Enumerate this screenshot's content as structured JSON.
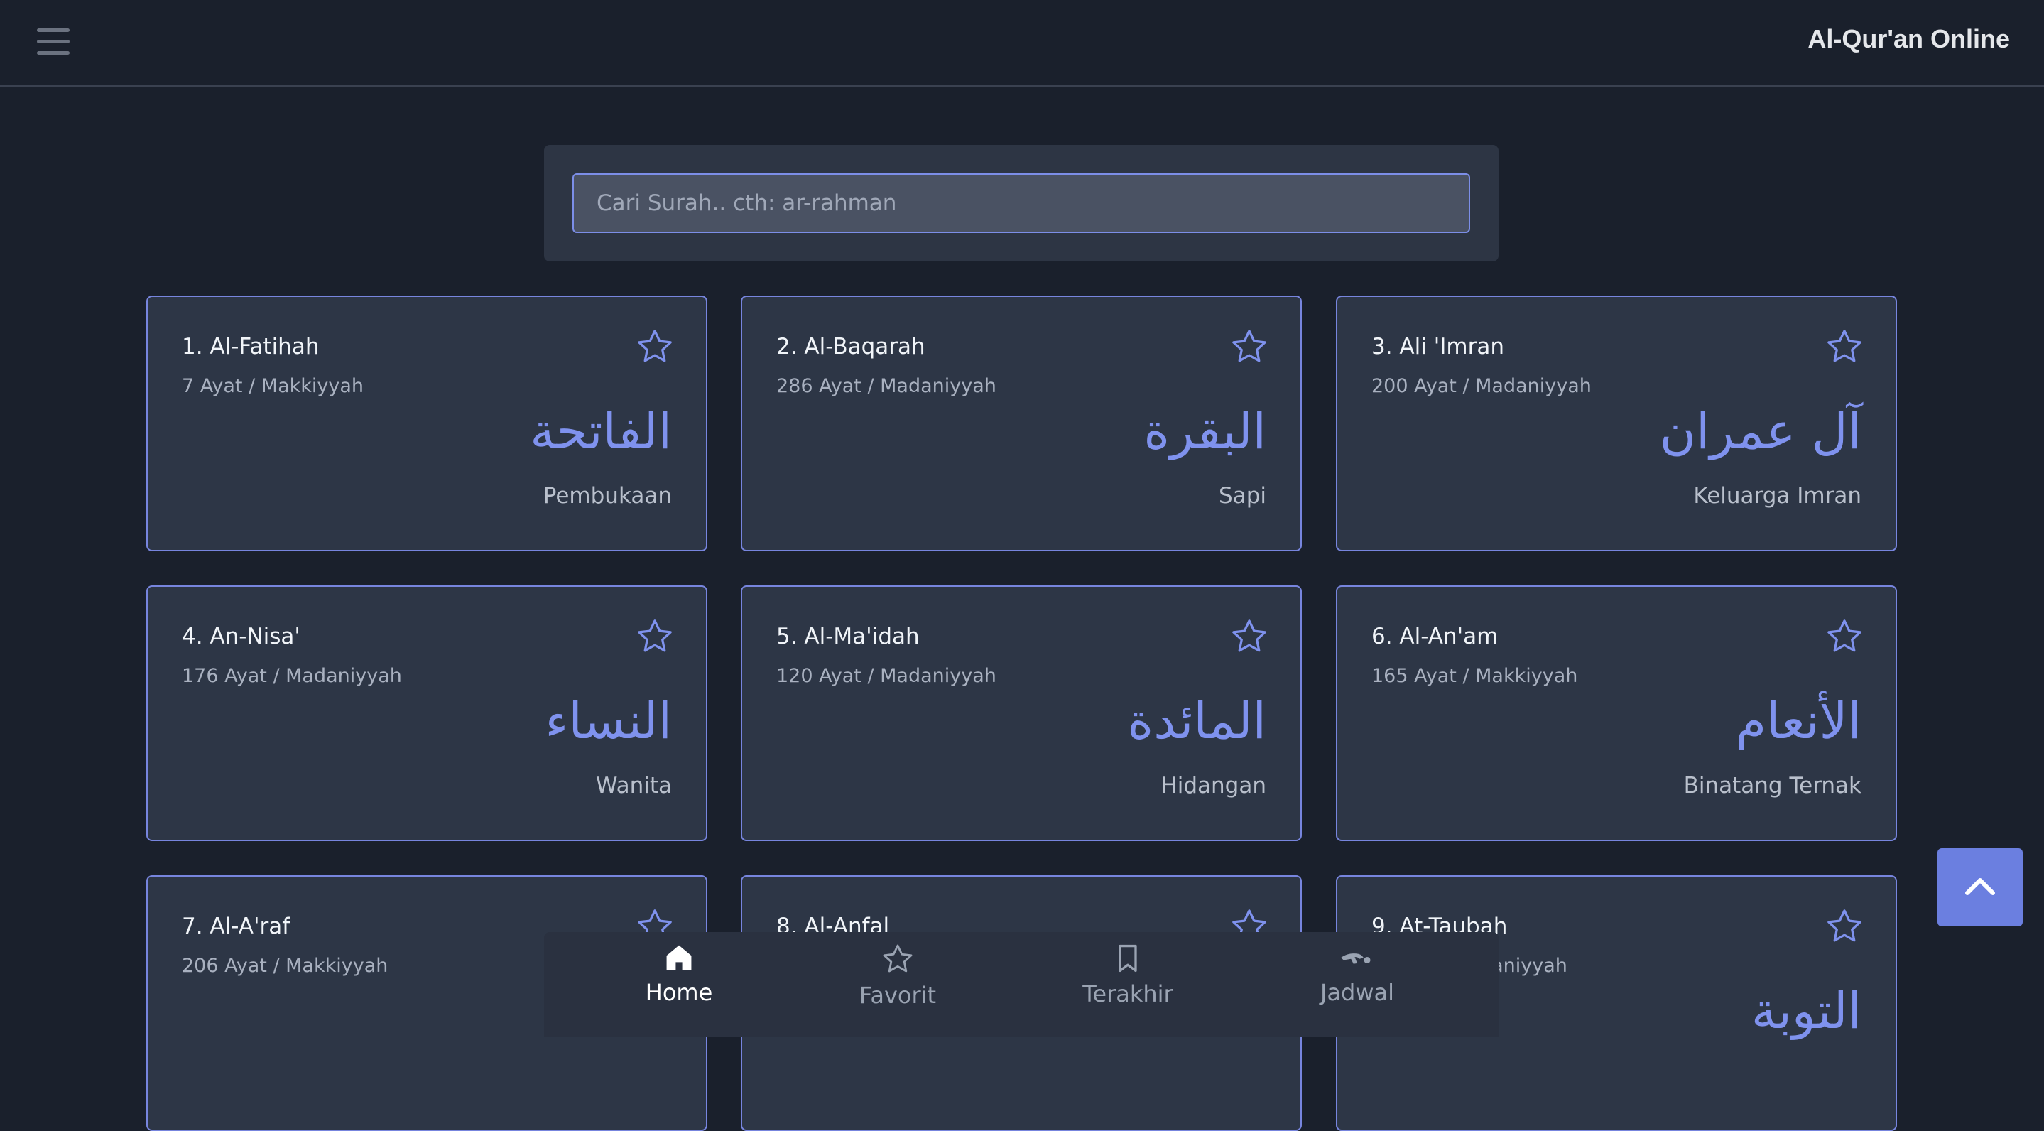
{
  "header": {
    "title": "Al-Qur'an Online"
  },
  "search": {
    "placeholder": "Cari Surah.. cth: ar-rahman",
    "value": ""
  },
  "surahs": [
    {
      "name": "1. Al-Fatihah",
      "meta": "7 Ayat / Makkiyyah",
      "arabic": "الفاتحة",
      "meaning": "Pembukaan"
    },
    {
      "name": "2. Al-Baqarah",
      "meta": "286 Ayat / Madaniyyah",
      "arabic": "البقرة",
      "meaning": "Sapi"
    },
    {
      "name": "3. Ali 'Imran",
      "meta": "200 Ayat / Madaniyyah",
      "arabic": "آل عمران",
      "meaning": "Keluarga Imran"
    },
    {
      "name": "4. An-Nisa'",
      "meta": "176 Ayat / Madaniyyah",
      "arabic": "النساء",
      "meaning": "Wanita"
    },
    {
      "name": "5. Al-Ma'idah",
      "meta": "120 Ayat / Madaniyyah",
      "arabic": "المائدة",
      "meaning": "Hidangan"
    },
    {
      "name": "6. Al-An'am",
      "meta": "165 Ayat / Makkiyyah",
      "arabic": "الأنعام",
      "meaning": "Binatang Ternak"
    },
    {
      "name": "7. Al-A'raf",
      "meta": "206 Ayat / Makkiyyah",
      "arabic": "",
      "meaning": ""
    },
    {
      "name": "8. Al-Anfal",
      "meta": "",
      "arabic": "",
      "meaning": ""
    },
    {
      "name": "9. At-Taubah",
      "meta": "daniyyah",
      "arabic": "التوبة",
      "meaning": ""
    }
  ],
  "nav": {
    "home": "Home",
    "favorit": "Favorit",
    "terakhir": "Terakhir",
    "jadwal": "Jadwal"
  },
  "icons": {
    "menu": "hamburger-icon",
    "favorite": "star-outline-icon",
    "home": "home-icon",
    "bookmark": "bookmark-icon",
    "prayer": "prayer-icon",
    "scroll_top": "chevron-up-icon"
  },
  "colors": {
    "accent": "#7f92ee",
    "background": "#1a202c",
    "card": "#2d3646",
    "card_border": "#7785de"
  }
}
